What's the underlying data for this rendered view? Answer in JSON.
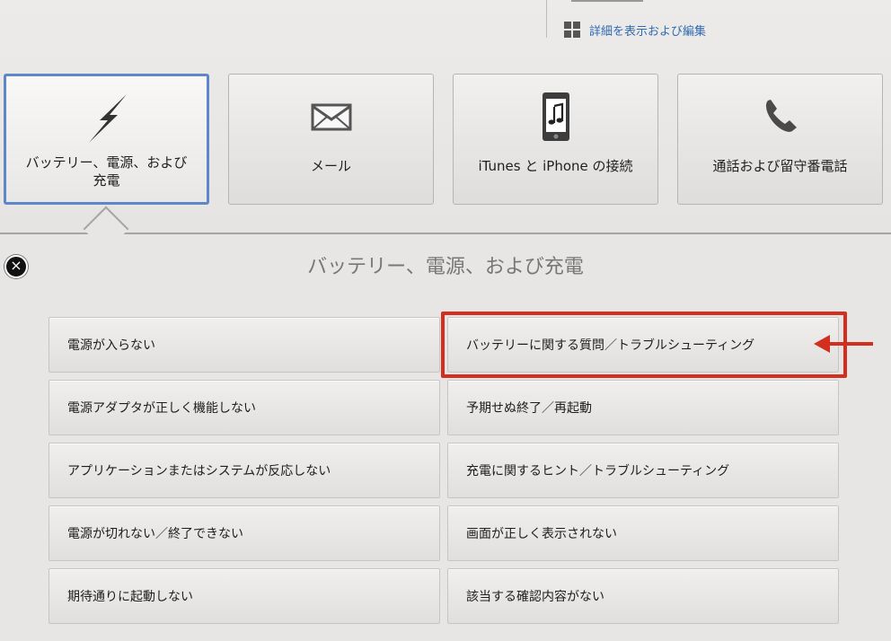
{
  "details_link": {
    "label": "詳細を表示および編集",
    "icon": "grid-icon"
  },
  "categories": [
    {
      "label": "バッテリー、電源、および充電",
      "icon": "lightning-bolt-icon",
      "selected": true
    },
    {
      "label": "メール",
      "icon": "envelope-icon",
      "selected": false
    },
    {
      "label": "iTunes と iPhone の接続",
      "icon": "music-phone-icon",
      "selected": false
    },
    {
      "label": "通話および留守番電話",
      "icon": "phone-handset-icon",
      "selected": false
    }
  ],
  "panel": {
    "title": "バッテリー、電源、および充電",
    "close_icon": "close-icon"
  },
  "topics": {
    "left": [
      "電源が入らない",
      "電源アダプタが正しく機能しない",
      "アプリケーションまたはシステムが反応しない",
      "電源が切れない／終了できない",
      "期待通りに起動しない"
    ],
    "right": [
      "バッテリーに関する質問／トラブルシューティング",
      "予期せぬ終了／再起動",
      "充電に関するヒント／トラブルシューティング",
      "画面が正しく表示されない",
      "該当する確認内容がない"
    ]
  },
  "annotation": {
    "color": "#d32f1f",
    "highlighted_topic": "バッテリーに関する質問／トラブルシューティング"
  }
}
